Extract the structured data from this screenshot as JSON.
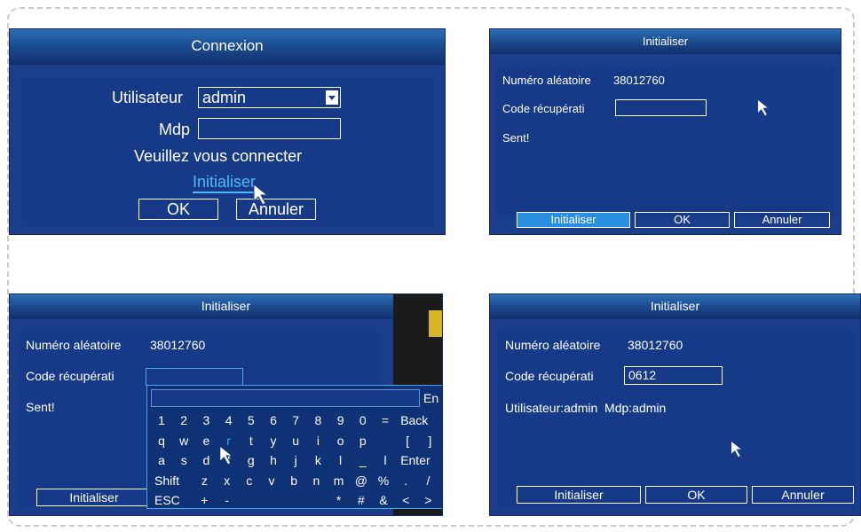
{
  "login": {
    "title": "Connexion",
    "user_label": "Utilisateur",
    "user_value": "admin",
    "pwd_label": "Mdp",
    "pwd_value": "",
    "message": "Veuillez vous connecter",
    "reset_link": "Initialiser",
    "ok": "OK",
    "cancel": "Annuler"
  },
  "init1": {
    "title": "Initialiser",
    "random_label": "Numéro aléatoire",
    "random_value": "38012760",
    "code_label": "Code récupérati",
    "code_value": "",
    "status": "Sent!",
    "btn_init": "Initialiser",
    "btn_ok": "OK",
    "btn_cancel": "Annuler"
  },
  "init2": {
    "title": "Initialiser",
    "random_label": "Numéro aléatoire",
    "random_value": "38012760",
    "code_label": "Code récupérati",
    "status": "Sent!",
    "btn_init": "Initialiser",
    "keyboard": {
      "lang": "En",
      "rows": [
        [
          "1",
          "2",
          "3",
          "4",
          "5",
          "6",
          "7",
          "8",
          "9",
          "0",
          "=",
          "Back"
        ],
        [
          "q",
          "w",
          "e",
          "r",
          "t",
          "y",
          "u",
          "i",
          "o",
          "p",
          "",
          "[",
          "]"
        ],
        [
          "a",
          "s",
          "d",
          "f",
          "g",
          "h",
          "j",
          "k",
          "l",
          "_",
          "l",
          "Enter"
        ],
        [
          "Shift",
          "z",
          "x",
          "c",
          "v",
          "b",
          "n",
          "m",
          "@",
          "%",
          ".",
          "/"
        ],
        [
          "ESC",
          "+",
          "-",
          "",
          "",
          "",
          "",
          "*",
          "#",
          "&",
          "<",
          ">"
        ]
      ]
    }
  },
  "init3": {
    "title": "Initialiser",
    "random_label": "Numéro aléatoire",
    "random_value": "38012760",
    "code_label": "Code récupérati",
    "code_value": "0612",
    "result": "Utilisateur:admin  Mdp:admin",
    "btn_init": "Initialiser",
    "btn_ok": "OK",
    "btn_cancel": "Annuler"
  }
}
